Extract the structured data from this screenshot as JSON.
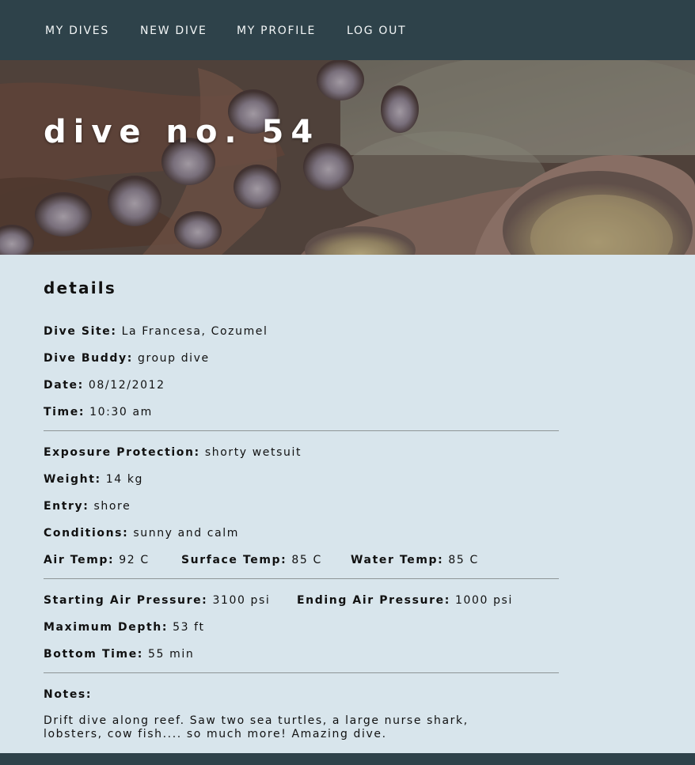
{
  "nav": {
    "my_dives": "MY DIVES",
    "new_dive": "NEW DIVE",
    "my_profile": "MY PROFILE",
    "log_out": "LOG OUT"
  },
  "hero": {
    "title": "dive no. 54"
  },
  "details": {
    "heading": "details",
    "dive_site": {
      "label": "Dive Site:",
      "value": "La Francesa, Cozumel"
    },
    "dive_buddy": {
      "label": "Dive Buddy:",
      "value": "group dive"
    },
    "date": {
      "label": "Date:",
      "value": "08/12/2012"
    },
    "time": {
      "label": "Time:",
      "value": "10:30 am"
    },
    "exposure_protection": {
      "label": "Exposure Protection:",
      "value": "shorty wetsuit"
    },
    "weight": {
      "label": "Weight:",
      "value": "14 kg"
    },
    "entry": {
      "label": "Entry:",
      "value": "shore"
    },
    "conditions": {
      "label": "Conditions:",
      "value": "sunny and calm"
    },
    "air_temp": {
      "label": "Air Temp:",
      "value": "92 C"
    },
    "surface_temp": {
      "label": "Surface Temp:",
      "value": "85 C"
    },
    "water_temp": {
      "label": "Water Temp:",
      "value": "85 C"
    },
    "starting_air_pressure": {
      "label": "Starting Air Pressure:",
      "value": "3100 psi"
    },
    "ending_air_pressure": {
      "label": "Ending Air Pressure:",
      "value": "1000 psi"
    },
    "maximum_depth": {
      "label": "Maximum Depth:",
      "value": "53 ft"
    },
    "bottom_time": {
      "label": "Bottom Time:",
      "value": "55 min"
    },
    "notes_label": "Notes:",
    "notes_text": "Drift dive along reef. Saw two sea turtles, a large nurse shark, lobsters, cow fish.... so much more! Amazing dive."
  },
  "colors": {
    "navbar": "#2e424a",
    "background": "#d8e5ec",
    "divider": "#8e9597"
  }
}
